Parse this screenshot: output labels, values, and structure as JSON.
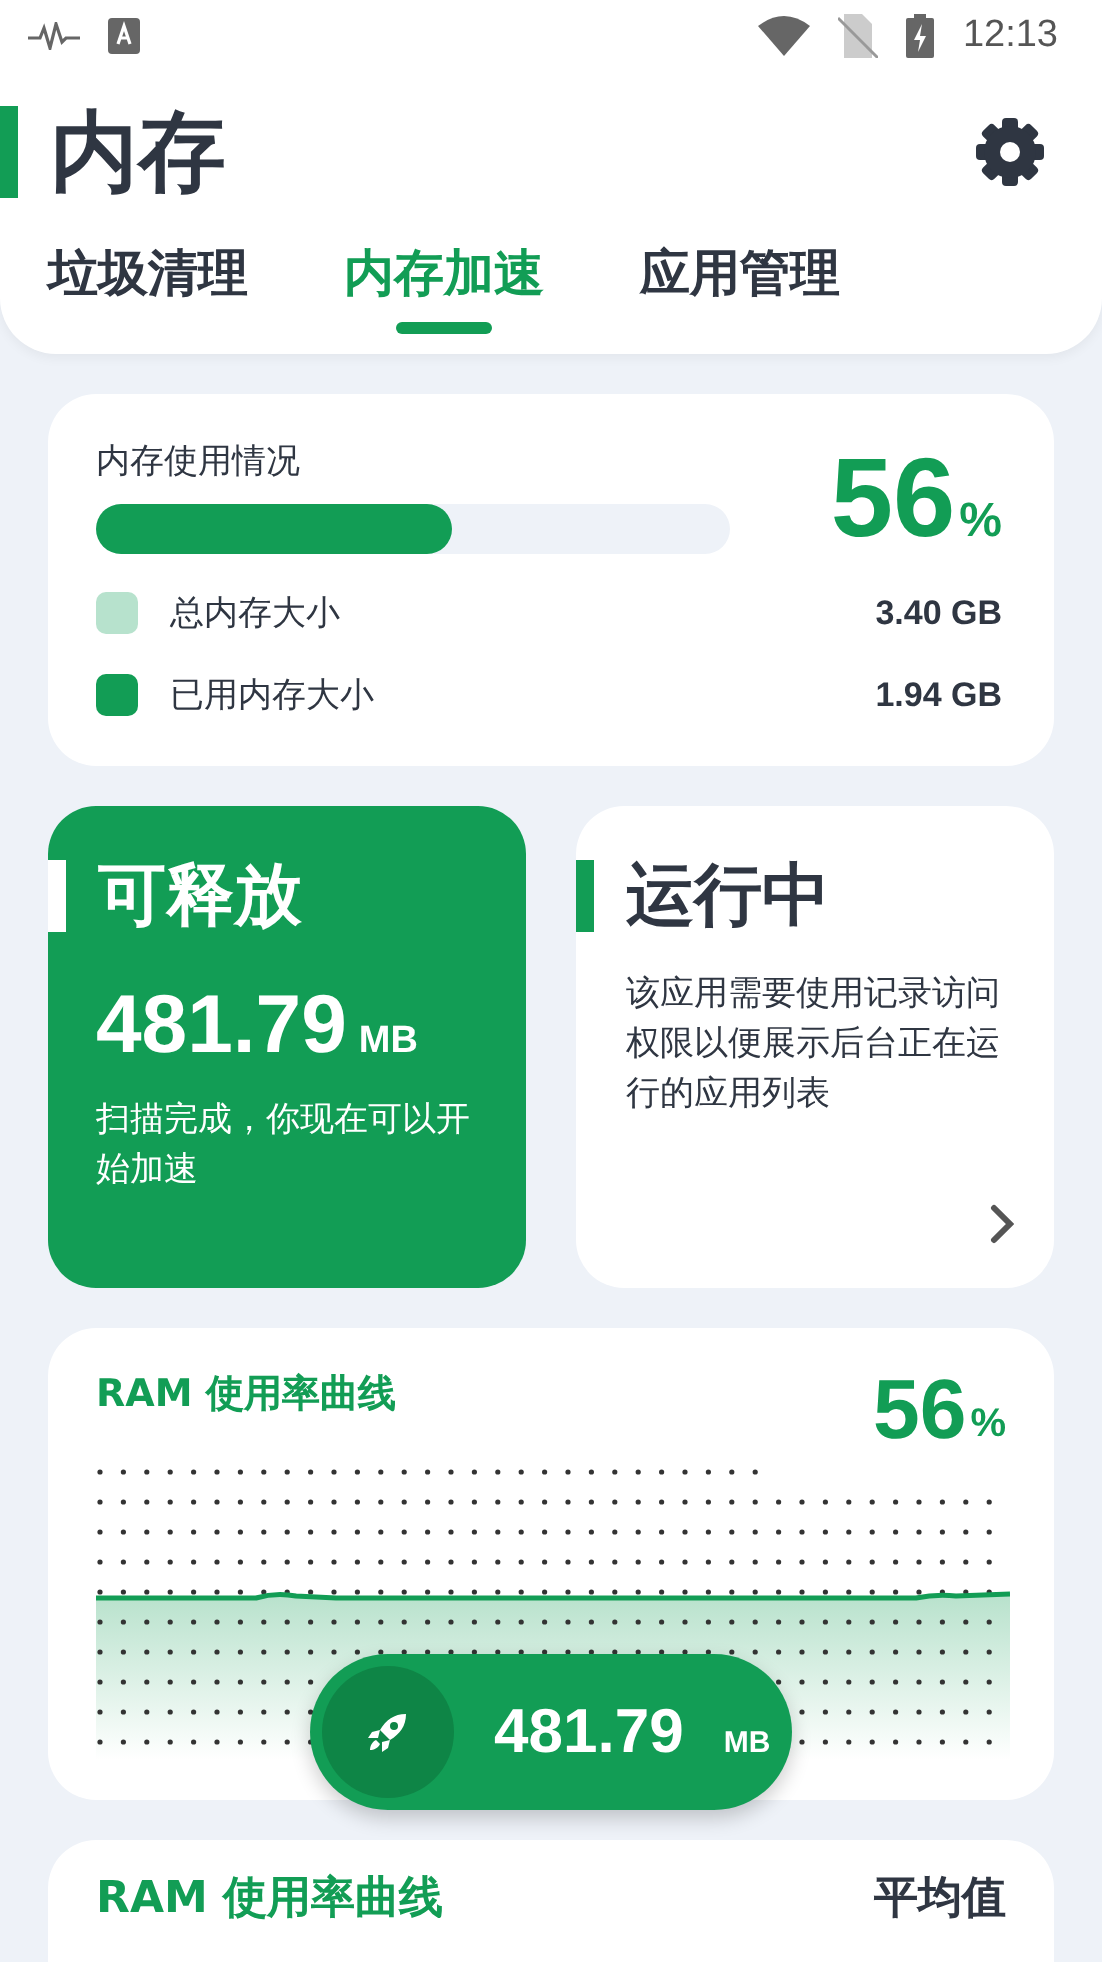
{
  "status_bar": {
    "time": "12:13"
  },
  "header": {
    "title": "内存"
  },
  "tabs": [
    {
      "label": "垃圾清理",
      "selected": false
    },
    {
      "label": "内存加速",
      "selected": true
    },
    {
      "label": "应用管理",
      "selected": false
    }
  ],
  "usage": {
    "title": "内存使用情况",
    "level": 0.56,
    "percent": "56",
    "percent_unit": "%",
    "legend": [
      {
        "label": "总内存大小",
        "value": "3.40 GB",
        "color": "#b7e2cd"
      },
      {
        "label": "已用内存大小",
        "value": "1.94 GB",
        "color": "#129d55"
      }
    ]
  },
  "free_card": {
    "title": "可释放",
    "amount": "481.79",
    "unit": "MB",
    "note": "扫描完成，你现在可以开始加速"
  },
  "running_card": {
    "title": "运行中",
    "note": "该应用需要使用记录访问权限以便展示后台正在运行的应用列表"
  },
  "chart_card": {
    "title": "RAM 使用率曲线",
    "percent": "56",
    "percent_unit": "%"
  },
  "boost_button": {
    "amount": "481.79",
    "unit": "MB"
  },
  "next_card": {
    "title": "RAM 使用率曲线",
    "label": "平均值"
  }
}
